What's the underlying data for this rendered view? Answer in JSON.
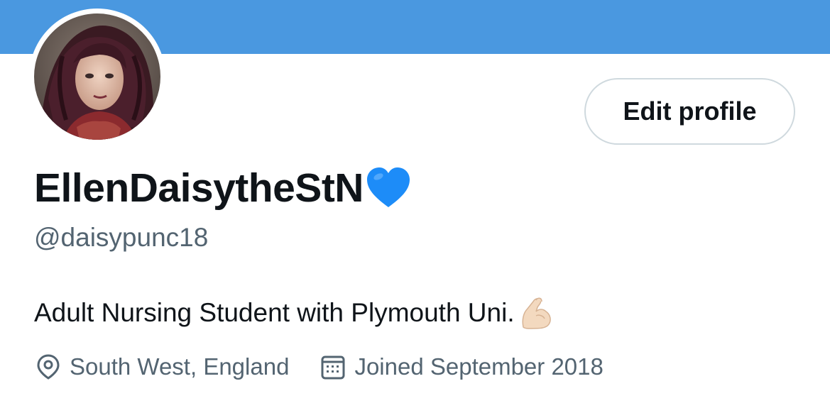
{
  "profile": {
    "display_name": "EllenDaisytheStN",
    "name_emoji": "blue-heart-icon",
    "handle": "@daisypunc18",
    "bio": "Adult Nursing Student with Plymouth Uni.",
    "bio_emoji": "flexed-biceps-icon",
    "location": "South West, England",
    "joined": "Joined September 2018"
  },
  "actions": {
    "edit_profile_label": "Edit profile"
  },
  "icons": {
    "location": "location-pin-icon",
    "joined": "calendar-icon"
  },
  "colors": {
    "banner": "#4a98e0",
    "primary_text": "#0f1419",
    "secondary_text": "#536471",
    "button_border": "#cfd9de",
    "heart": "#1d8cf8"
  }
}
